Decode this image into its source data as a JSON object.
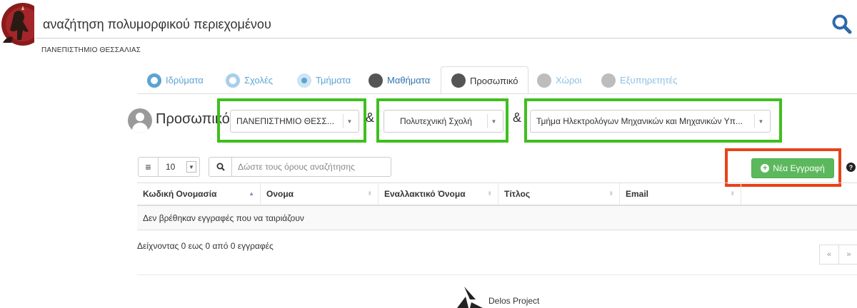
{
  "header": {
    "app_title": "αναζήτηση πολυμορφικού περιεχομένου",
    "university": "ΠΑΝΕΠΙΣΤΗΜΙΟ ΘΕΣΣΑΛΙΑΣ",
    "search_icon": "search-icon"
  },
  "tabs": [
    {
      "label": "Ιδρύματα",
      "icon": "ring-icon",
      "state": "ring"
    },
    {
      "label": "Σχολές",
      "icon": "ring-icon",
      "state": "dot"
    },
    {
      "label": "Τμήματα",
      "icon": "dot-icon",
      "state": "dot"
    },
    {
      "label": "Μαθήματα",
      "icon": "book-icon",
      "state": "dark"
    },
    {
      "label": "Προσωπικό",
      "icon": "user-icon",
      "state": "active"
    },
    {
      "label": "Χώροι",
      "icon": "car-icon",
      "state": "disabled"
    },
    {
      "label": "Εξυπηρετητές",
      "icon": "server-icon",
      "state": "disabled"
    }
  ],
  "section": {
    "title": "Προσωπικό",
    "amp": "&"
  },
  "filters": {
    "institution": "ΠΑΝΕΠΙΣΤΗΜΙΟ ΘΕΣΣ...",
    "school": "Πολυτεχνική Σχολή",
    "department": "Τμήμα Ηλεκτρολόγων Μηχανικών και Μηχανικών Υπ..."
  },
  "controls": {
    "page_length": "10",
    "search_placeholder": "Δώστε τους όρους αναζήτησης",
    "new_record_label": "Νέα Εγγραφή",
    "help": "?"
  },
  "table": {
    "columns": [
      "Κωδική Ονομασία",
      "Ονομα",
      "Εναλλακτικό Όνομα",
      "Τίτλος",
      "Email",
      ""
    ],
    "empty_message": "Δεν βρέθηκαν εγγραφές που να ταιριάζουν",
    "info": "Δείχνοντας 0 εως 0 από 0 εγγραφές",
    "pager": {
      "prev": "«",
      "next": "»"
    }
  },
  "footer": {
    "project": "Delos Project"
  },
  "colors": {
    "highlight_green": "#3fbf1f",
    "highlight_red": "#e8421a",
    "button_green": "#5cb85c",
    "tab_blue": "#5ba4d4",
    "logo_maroon": "#8b1a1a"
  }
}
